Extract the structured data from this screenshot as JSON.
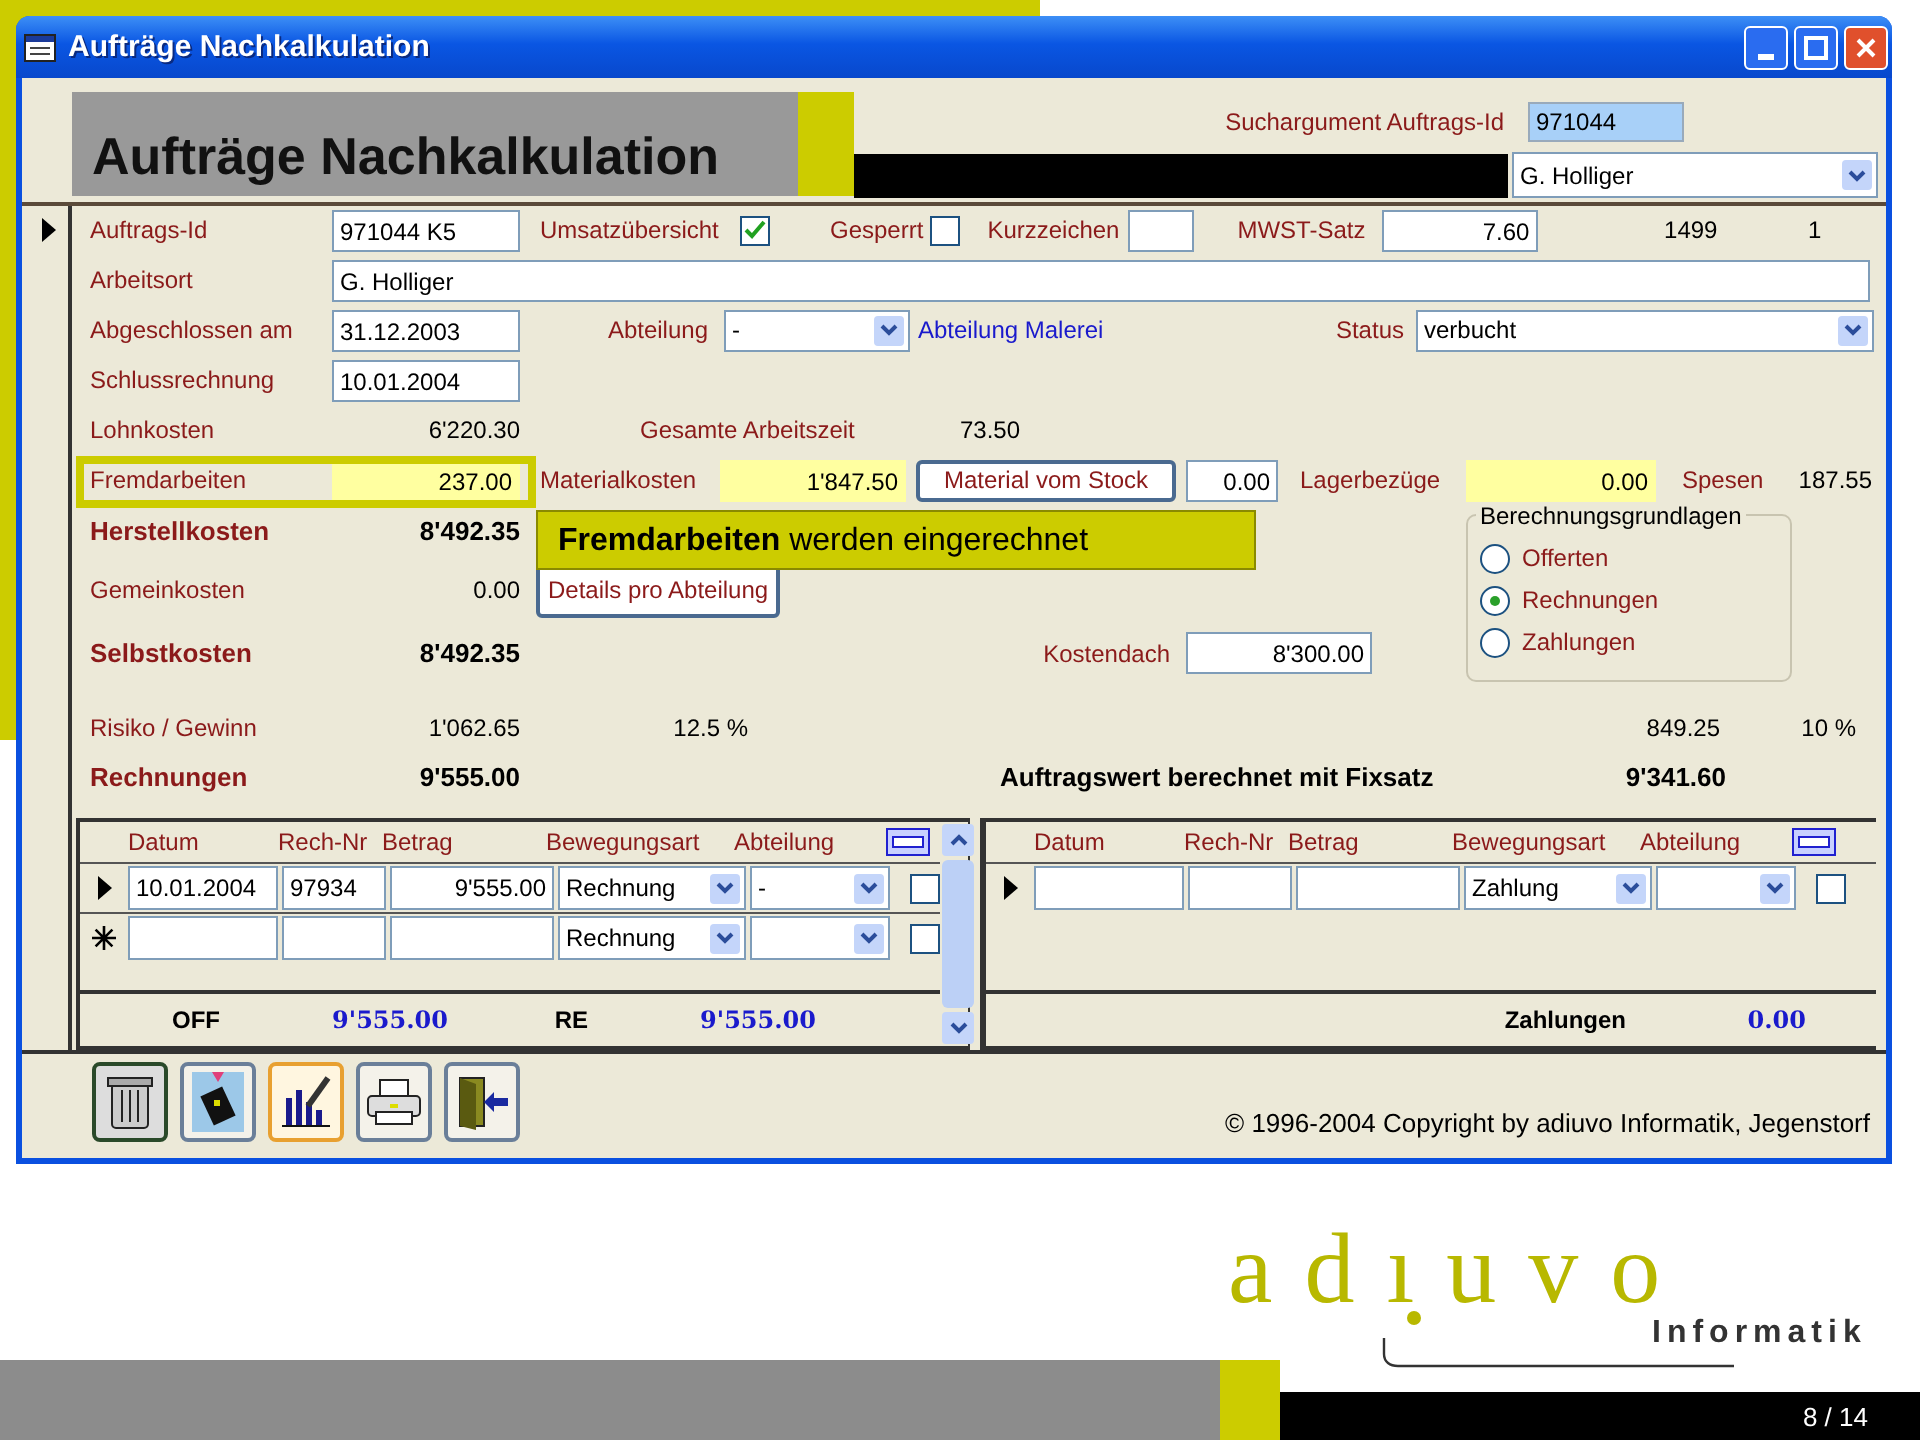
{
  "window": {
    "title": "Aufträge Nachkalkulation"
  },
  "header": {
    "title": "Aufträge Nachkalkulation",
    "search_label": "Suchargument Auftrags-Id",
    "search_value": "971044",
    "person": "G. Holliger"
  },
  "fields": {
    "auftrags_id": {
      "label": "Auftrags-Id",
      "value": "971044 K5"
    },
    "umsatz": {
      "label": "Umsatzübersicht",
      "checked": true
    },
    "gesperrt": {
      "label": "Gesperrt",
      "checked": false
    },
    "kurzzeichen": {
      "label": "Kurzzeichen"
    },
    "mwst": {
      "label": "MWST-Satz",
      "value": "7.60"
    },
    "number_1": "1499",
    "number_2": "1",
    "arbeitsort": {
      "label": "Arbeitsort",
      "value": "G. Holliger"
    },
    "abgeschlossen": {
      "label": "Abgeschlossen am",
      "value": "31.12.2003"
    },
    "abteilung": {
      "label": "Abteilung",
      "value": "-",
      "name": "Abteilung Malerei"
    },
    "status": {
      "label": "Status",
      "value": "verbucht"
    },
    "schlussrechnung": {
      "label": "Schlussrechnung",
      "value": "10.01.2004"
    }
  },
  "costs": {
    "lohnkosten": {
      "label": "Lohnkosten",
      "value": "6'220.30"
    },
    "arbeitszeit": {
      "label": "Gesamte Arbeitszeit",
      "value": "73.50"
    },
    "fremdarbeiten": {
      "label": "Fremdarbeiten",
      "value": "237.00",
      "highlighted": true
    },
    "materialkosten": {
      "label": "Materialkosten",
      "value": "1'847.50"
    },
    "material_button": "Material vom Stock",
    "material_stock": "0.00",
    "lagerbezuege": {
      "label": "Lagerbezüge",
      "value": "0.00"
    },
    "spesen": {
      "label": "Spesen",
      "value": "187.55"
    },
    "herstellkosten": {
      "label": "Herstellkosten",
      "value": "8'492.35"
    },
    "gemeinkosten": {
      "label": "Gemeinkosten",
      "value": "0.00"
    },
    "details_button": "Details pro Abteilung",
    "selbstkosten": {
      "label": "Selbstkosten",
      "value": "8'492.35"
    },
    "kostendach": {
      "label": "Kostendach",
      "value": "8'300.00"
    },
    "risiko": {
      "label": "Risiko / Gewinn",
      "value": "1'062.65",
      "percent": "12.5  %",
      "fix_value": "849.25",
      "fix_percent": "10 %"
    },
    "rechnungen": {
      "label": "Rechnungen",
      "value": "9'555.00"
    },
    "auftragswert": {
      "label": "Auftragswert berechnet mit Fixsatz",
      "value": "9'341.60"
    }
  },
  "basis": {
    "title": "Berechnungsgrundlagen",
    "options": [
      {
        "label": "Offerten",
        "selected": false
      },
      {
        "label": "Rechnungen",
        "selected": true
      },
      {
        "label": "Zahlungen",
        "selected": false
      }
    ]
  },
  "callout": {
    "text": "**Fremdarbeiten** werden eingerechnet"
  },
  "subforms": [
    {
      "columns": [
        "Datum",
        "Rech-Nr",
        "Betrag",
        "Bewegungsart",
        "Abteilung"
      ],
      "scrollbar": true,
      "rows": [
        {
          "kind": "current",
          "datum": "10.01.2004",
          "rech_nr": "97934",
          "betrag": "9'555.00",
          "bewegungsart": "Rechnung",
          "abteilung": "-",
          "checked": false
        },
        {
          "kind": "new",
          "bewegungsart": "Rechnung",
          "checked": false
        }
      ],
      "footer": [
        {
          "kind": "label",
          "text": "OFF"
        },
        {
          "kind": "sum",
          "text": "9'555.00"
        },
        {
          "kind": "label",
          "text": "RE"
        },
        {
          "kind": "sum",
          "text": "9'555.00"
        }
      ]
    },
    {
      "columns": [
        "Datum",
        "Rech-Nr",
        "Betrag",
        "Bewegungsart",
        "Abteilung"
      ],
      "scrollbar": false,
      "rows": [
        {
          "kind": "current",
          "bewegungsart": "Zahlung",
          "checked": false
        }
      ],
      "footer": [
        {
          "kind": "label",
          "text": "Zahlungen"
        },
        {
          "kind": "sum",
          "text": "0.00"
        }
      ]
    }
  ],
  "toolbar": [
    {
      "kind": "delete",
      "pressed": true
    },
    {
      "kind": "phone",
      "pressed": false
    },
    {
      "kind": "chart",
      "pressed": true
    },
    {
      "kind": "print",
      "pressed": false
    },
    {
      "kind": "exit",
      "pressed": false
    }
  ],
  "copyright": "© 1996-2004 Copyright by adiuvo Informatik, Jegenstorf",
  "slide": {
    "logo": "adıuvo",
    "logo_sub": "Informatik",
    "page": "8 / 14"
  }
}
